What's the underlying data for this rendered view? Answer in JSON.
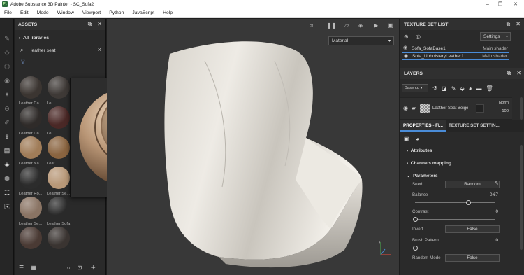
{
  "window": {
    "title": "Adobe Substance 3D Painter - SC_Sofa2",
    "logo": "Pt"
  },
  "menu": [
    "File",
    "Edit",
    "Mode",
    "Window",
    "Viewport",
    "Python",
    "JavaScript",
    "Help"
  ],
  "assets": {
    "title": "ASSETS",
    "libraries": "All libraries",
    "search_value": "leather seat",
    "thumbnails": [
      {
        "label": "Leather Ca...",
        "color": "#3b3531"
      },
      {
        "label": "Le",
        "color": "#3e3936"
      },
      {
        "label": "Leather Da...",
        "color": "#2f2b29"
      },
      {
        "label": "Le",
        "color": "#4a2826"
      },
      {
        "label": "Leather Na...",
        "color": "#a07c58"
      },
      {
        "label": "Leat",
        "color": "#8a6440"
      },
      {
        "label": "Leather Ro...",
        "color": "#2c2c2c"
      },
      {
        "label": "Leather Se...",
        "color": "#b89878"
      },
      {
        "label": "Leather Se...",
        "color": "#8a7464"
      },
      {
        "label": "Leather Sofa",
        "color": "#2a2a2a"
      },
      {
        "label": "",
        "color": "#4a3a34"
      },
      {
        "label": "",
        "color": "#3a3431"
      }
    ],
    "preview_label": "Leather Seat Beige"
  },
  "viewport": {
    "material_mode": "Material"
  },
  "texture_set_list": {
    "title": "TEXTURE SET LIST",
    "settings_label": "Settings",
    "rows": [
      {
        "name": "Sofa_SofaBase1",
        "shader": "Main shader"
      },
      {
        "name": "Sofa_UpholsteryLeather1",
        "shader": "Main shader"
      }
    ]
  },
  "layers": {
    "title": "LAYERS",
    "channel": "Base co",
    "layer_name": "Leather Seat Beige",
    "blend": "Norm",
    "opacity": "100"
  },
  "properties": {
    "tab_active": "PROPERTIES - FI...",
    "tab_inactive": "TEXTURE SET SETTIN...",
    "attributes": "Attributes",
    "channels_mapping": "Channels mapping",
    "parameters": "Parameters",
    "seed_label": "Seed",
    "seed_value": "Random",
    "balance_label": "Balance",
    "balance_value": "0.67",
    "contrast_label": "Contrast",
    "contrast_value": "0",
    "invert_label": "Invert",
    "invert_value": "False",
    "brush_pattern_label": "Brush Pattern",
    "brush_pattern_value": "0",
    "random_mode_label": "Random Mode",
    "random_mode_value": "False"
  }
}
